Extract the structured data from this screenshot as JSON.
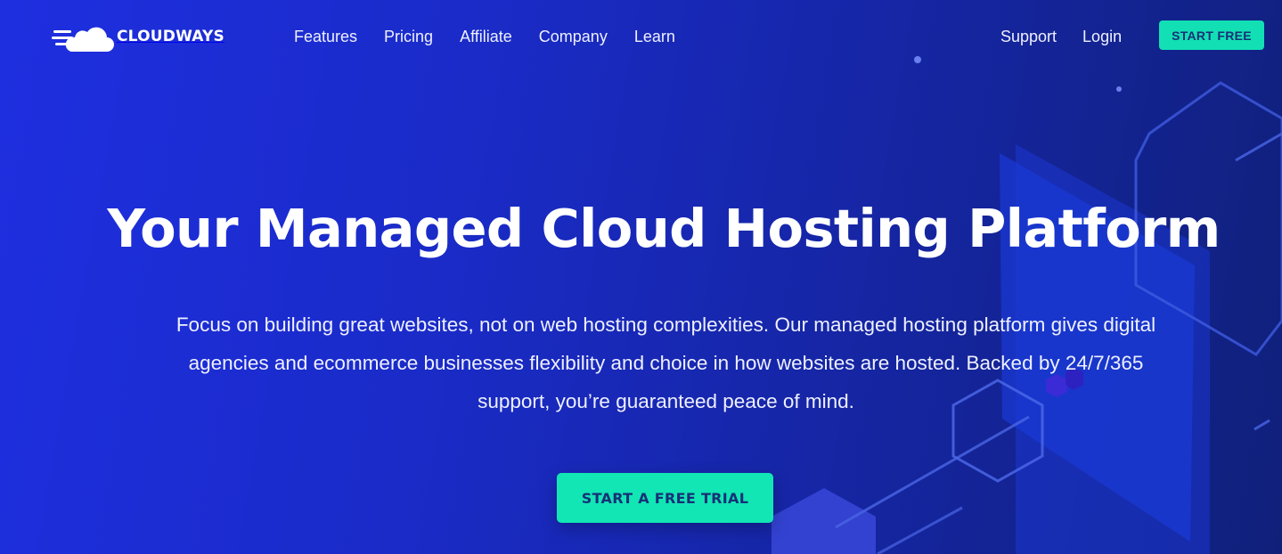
{
  "brand": {
    "name": "CLOUDWAYS",
    "logo_icon": "cloudways-cloud-logo"
  },
  "nav": {
    "items": [
      {
        "label": "Features"
      },
      {
        "label": "Pricing"
      },
      {
        "label": "Affiliate"
      },
      {
        "label": "Company"
      },
      {
        "label": "Learn"
      }
    ],
    "support_label": "Support",
    "login_label": "Login",
    "cta_label": "START FREE"
  },
  "hero": {
    "title": "Your Managed Cloud Hosting Platform",
    "description": "Focus on building great websites, not on web hosting complexities. Our managed hosting platform gives digital agencies and ecommerce businesses flexibility and choice in how websites are hosted. Backed by 24/7/365 support, you’re guaranteed peace of mind.",
    "cta_label": "START A FREE TRIAL"
  },
  "colors": {
    "background_start": "#1e2fe0",
    "background_end": "#10207a",
    "accent": "#12e0b4",
    "button_text": "#173077"
  }
}
